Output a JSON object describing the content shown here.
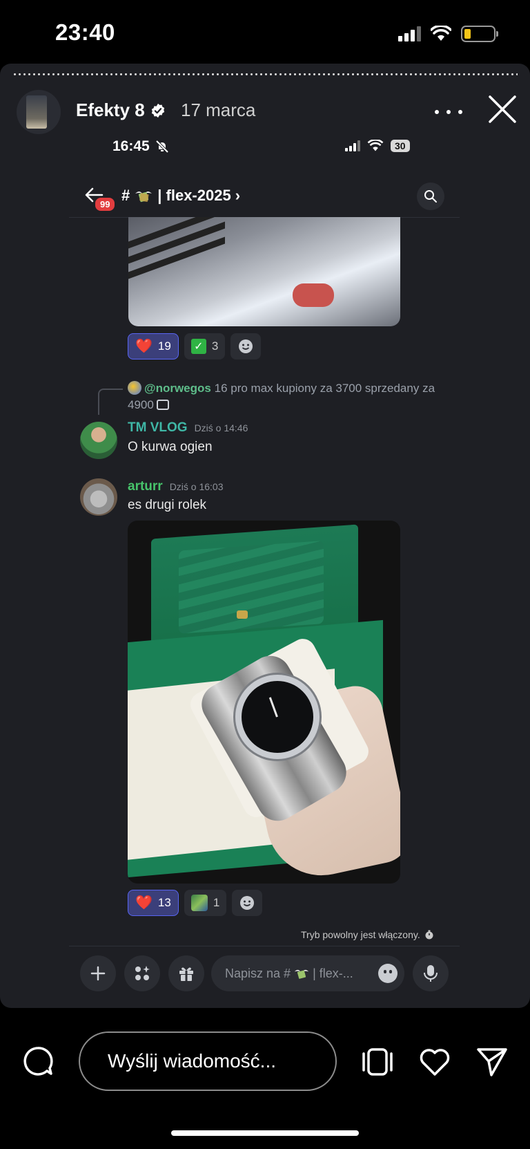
{
  "status_bar": {
    "time": "23:40"
  },
  "story": {
    "username": "Efekty 8",
    "date": "17 marca",
    "reply_placeholder": "Wyślij wiadomość..."
  },
  "inner": {
    "time": "16:45",
    "battery": "30",
    "channel": {
      "unread_count": "99",
      "hash": "#",
      "name": "| flex-2025",
      "chevron": "›"
    },
    "reactions_1": [
      {
        "emoji": "❤️",
        "count": "19"
      },
      {
        "emoji": "✅",
        "count": "3"
      }
    ],
    "reply": {
      "author": "@norwegos",
      "text": "16 pro max kupiony za 3700 sprzedany za 4900"
    },
    "messages": [
      {
        "author": "TM VLOG",
        "time": "Dziś o 14:46",
        "text": "O kurwa ogien"
      },
      {
        "author": "arturr",
        "time": "Dziś o 16:03",
        "text": "es drugi rolek"
      }
    ],
    "reactions_2": [
      {
        "emoji": "❤️",
        "count": "13"
      },
      {
        "emoji": "sticker",
        "count": "1"
      }
    ],
    "slow_mode": "Tryb powolny jest włączony.",
    "composer_placeholder_prefix": "Napisz na #",
    "composer_placeholder_suffix": "| flex-..."
  },
  "colors": {
    "accent": "#5865f2",
    "story_bg": "#1e1f24",
    "tmvlog_name": "#3fb7a6",
    "arturr_name": "#47c46b",
    "badge": "#e23d3f"
  }
}
